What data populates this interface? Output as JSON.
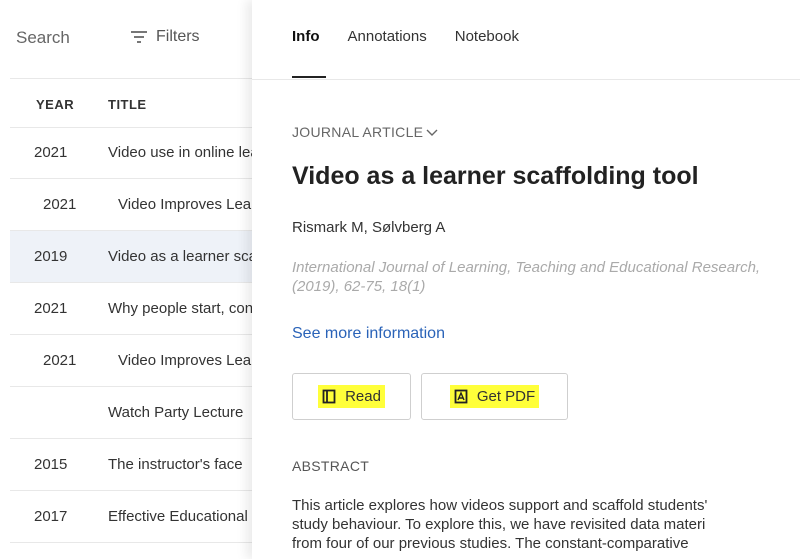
{
  "left": {
    "search_label": "Search",
    "filters_label": "Filters",
    "columns": {
      "year": "YEAR",
      "title": "TITLE"
    },
    "rows": [
      {
        "lead": "",
        "year": "2021",
        "title": "Video use in online learning",
        "selected": false
      },
      {
        "lead": ".",
        "year": "2021",
        "title": "Video Improves Learning",
        "selected": false
      },
      {
        "lead": "",
        "year": "2019",
        "title": "Video as a learner scaffolding tool",
        "selected": true
      },
      {
        "lead": "",
        "year": "2021",
        "title": "Why people start, continue",
        "selected": false
      },
      {
        "lead": ".",
        "year": "2021",
        "title": "Video Improves Learning",
        "selected": false
      },
      {
        "lead": "",
        "year": "",
        "title": "Watch Party Lecture",
        "selected": false
      },
      {
        "lead": "",
        "year": "2015",
        "title": "The instructor's face",
        "selected": false
      },
      {
        "lead": "",
        "year": "2017",
        "title": "Effective Educational Videos",
        "selected": false
      }
    ]
  },
  "panel": {
    "tabs": [
      {
        "label": "Info",
        "active": true
      },
      {
        "label": "Annotations",
        "active": false
      },
      {
        "label": "Notebook",
        "active": false
      }
    ],
    "type": "JOURNAL ARTICLE",
    "title": "Video as a learner scaffolding tool",
    "authors": "Rismark M, Sølvberg A",
    "citation": "International Journal of Learning, Teaching and Educational Research, (2019), 62-75, 18(1)",
    "see_more": "See more information",
    "read_label": "Read",
    "pdf_label": "Get PDF",
    "abstract_heading": "ABSTRACT",
    "abstract_lines": [
      "This article explores how videos support and scaffold students'",
      "study behaviour. To explore this, we have revisited data materi",
      "from four of our previous studies. The constant-comparative"
    ]
  }
}
